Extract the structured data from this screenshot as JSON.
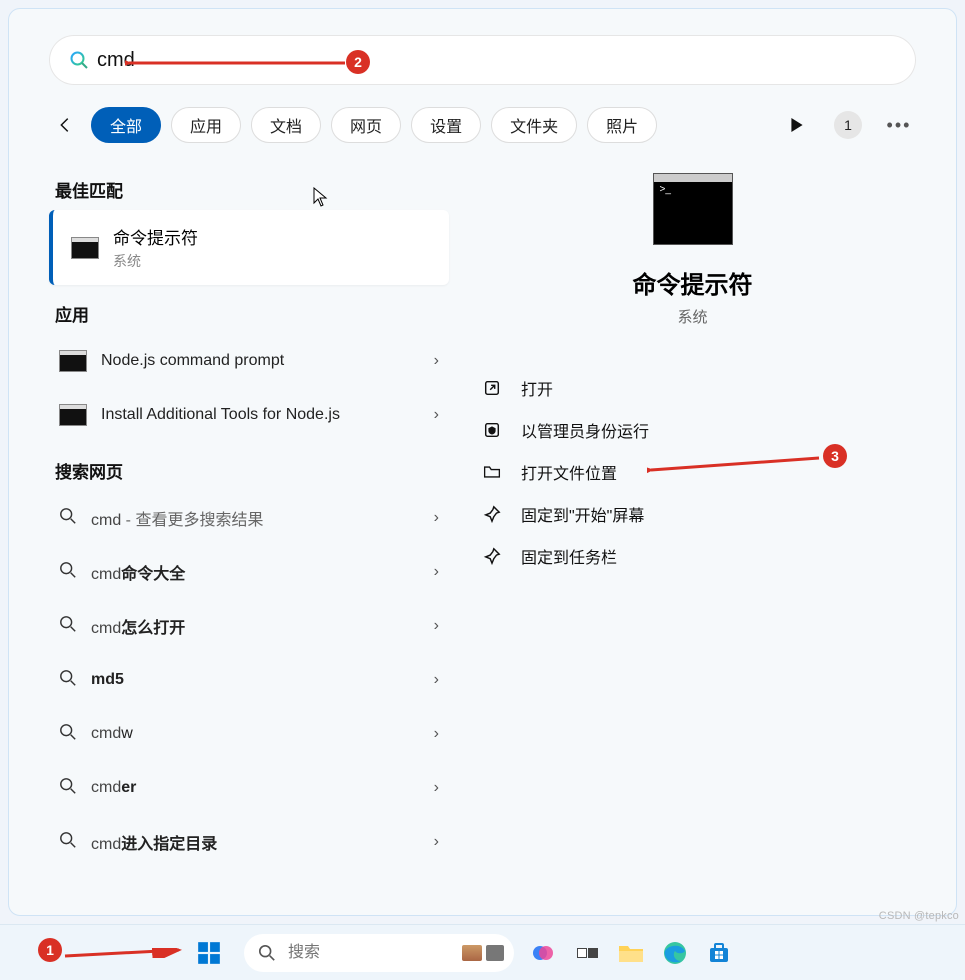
{
  "search": {
    "value": "cmd",
    "placeholder": ""
  },
  "tabs": [
    "全部",
    "应用",
    "文档",
    "网页",
    "设置",
    "文件夹",
    "照片"
  ],
  "toolbar_count": "1",
  "sections": {
    "best": "最佳匹配",
    "apps": "应用",
    "web": "搜索网页"
  },
  "best_match": {
    "title": "命令提示符",
    "subtitle": "系统"
  },
  "apps": [
    {
      "title": "Node.js command prompt"
    },
    {
      "title": "Install Additional Tools for Node.js"
    }
  ],
  "web_results": [
    {
      "prefix": "cmd",
      "bold": "",
      "suffix": "",
      "extra": " - 查看更多搜索结果"
    },
    {
      "prefix": "cmd",
      "bold": "命令大全",
      "suffix": "",
      "extra": ""
    },
    {
      "prefix": "cmd",
      "bold": "怎么打开",
      "suffix": "",
      "extra": ""
    },
    {
      "prefix": "",
      "bold": "md5",
      "suffix": "",
      "extra": ""
    },
    {
      "prefix": "cmd",
      "bold": "",
      "suffix": "w",
      "extra": ""
    },
    {
      "prefix": "cmd",
      "bold": "er",
      "suffix": "",
      "extra": ""
    },
    {
      "prefix": "cmd",
      "bold": "进入指定目录",
      "suffix": "",
      "extra": ""
    }
  ],
  "detail": {
    "title": "命令提示符",
    "kind": "系统"
  },
  "actions": [
    {
      "icon": "open",
      "label": "打开"
    },
    {
      "icon": "shield",
      "label": "以管理员身份运行"
    },
    {
      "icon": "folder",
      "label": "打开文件位置"
    },
    {
      "icon": "pin",
      "label": "固定到\"开始\"屏幕"
    },
    {
      "icon": "pin",
      "label": "固定到任务栏"
    }
  ],
  "taskbar": {
    "search_placeholder": "搜索"
  },
  "annotations": {
    "a1": "1",
    "a2": "2",
    "a3": "3"
  },
  "watermark": "CSDN @tepkco"
}
